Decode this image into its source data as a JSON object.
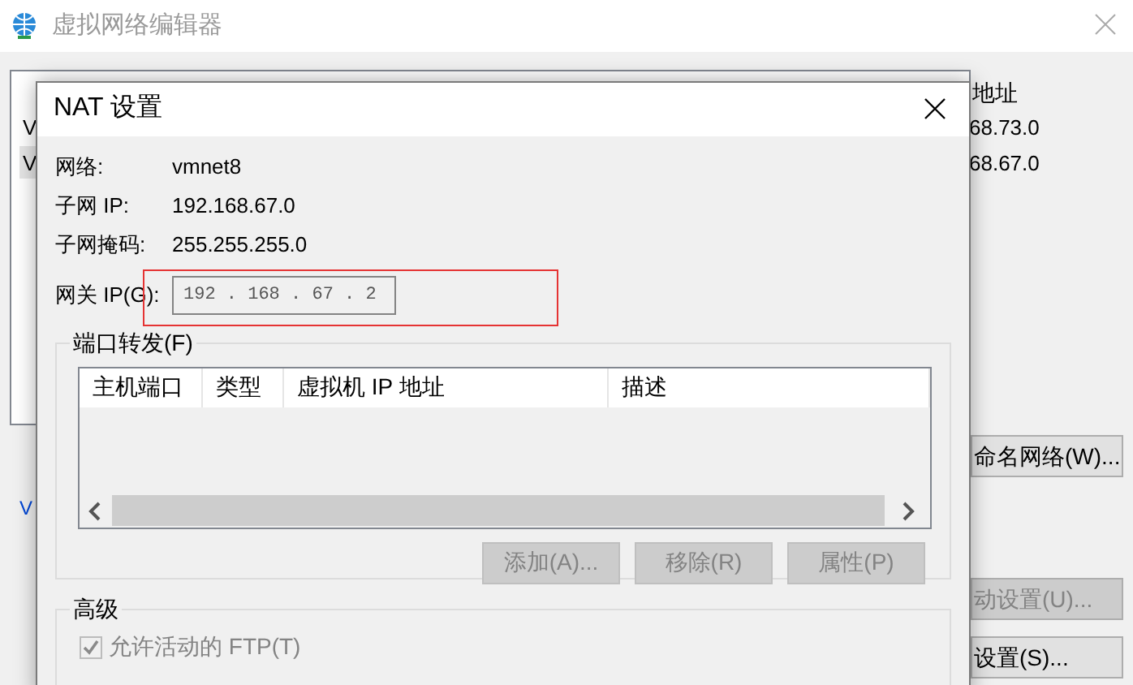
{
  "window": {
    "title": "虚拟网络编辑器"
  },
  "network_list": {
    "header_visible": "地址",
    "rows": [
      {
        "name": "V",
        "subnet": "68.73.0",
        "selected": false
      },
      {
        "name": "V",
        "subnet": "68.67.0",
        "selected": true
      }
    ]
  },
  "side_buttons": [
    {
      "label": "命名网络(W)...",
      "disabled": false
    },
    {
      "label": "动设置(U)...",
      "disabled": true
    },
    {
      "label": "设置(S)...",
      "disabled": false
    }
  ],
  "group_label": "V",
  "dialog": {
    "title": "NAT 设置",
    "info": [
      {
        "label": "网络:",
        "value": "vmnet8"
      },
      {
        "label": "子网 IP:",
        "value": "192.168.67.0"
      },
      {
        "label": "子网掩码:",
        "value": "255.255.255.0"
      }
    ],
    "gateway": {
      "label": "网关 IP(G):",
      "value": "192 . 168 . 67 . 2",
      "disabled": true,
      "highlighted": true
    },
    "port_forwarding": {
      "title": "端口转发(F)",
      "columns": [
        "主机端口",
        "类型",
        "虚拟机 IP 地址",
        "描述"
      ],
      "buttons": [
        {
          "label": "添加(A)...",
          "disabled": true
        },
        {
          "label": "移除(R)",
          "disabled": true
        },
        {
          "label": "属性(P)",
          "disabled": true
        }
      ]
    },
    "advanced": {
      "title": "高级",
      "checkbox": {
        "label": "允许活动的 FTP(T)",
        "checked": true,
        "disabled": true
      }
    }
  }
}
